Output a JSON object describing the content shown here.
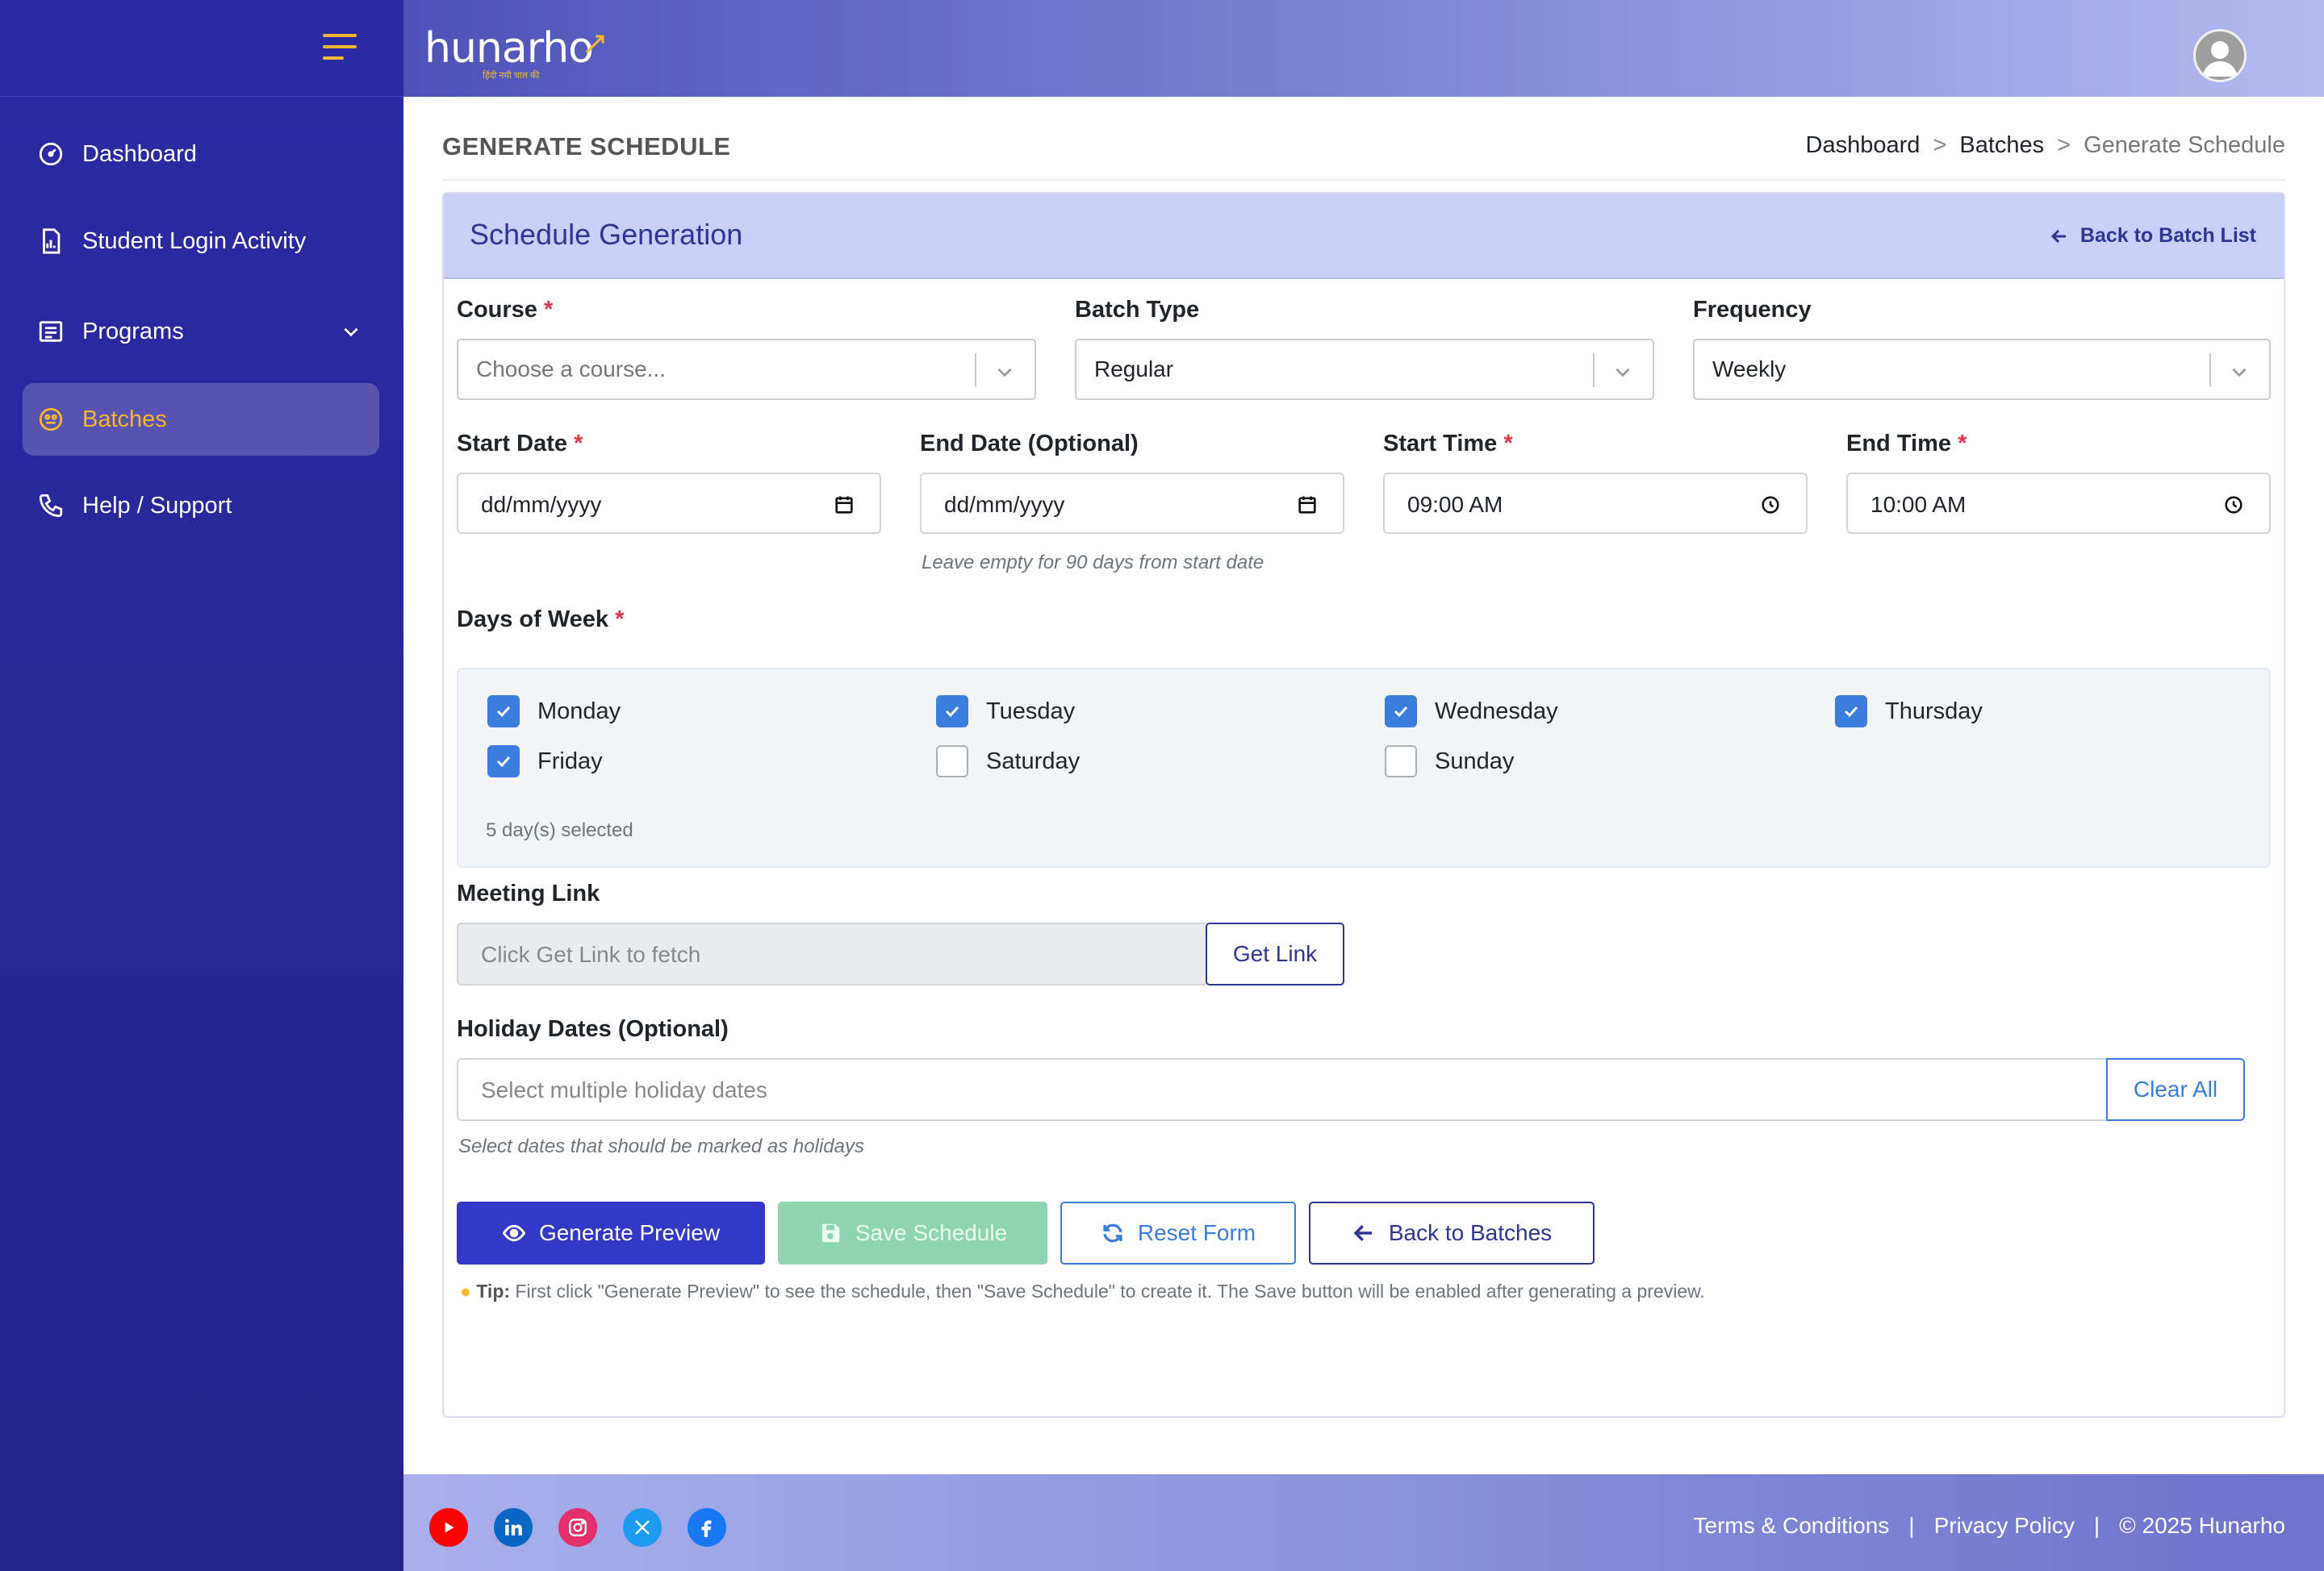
{
  "brand": {
    "logo_text": "hunarho",
    "logo_tagline": "हिंदी नयी चाल की"
  },
  "sidebar": {
    "items": [
      {
        "label": "Dashboard"
      },
      {
        "label": "Student Login Activity"
      },
      {
        "label": "Programs"
      },
      {
        "label": "Batches"
      },
      {
        "label": "Help / Support"
      }
    ],
    "active": "Batches"
  },
  "page": {
    "title": "GENERATE SCHEDULE",
    "breadcrumb": [
      "Dashboard",
      "Batches",
      "Generate Schedule"
    ],
    "breadcrumb_sep": ">"
  },
  "card": {
    "title": "Schedule Generation",
    "back_link": "Back to Batch List"
  },
  "form": {
    "course": {
      "label": "Course",
      "placeholder": "Choose a course..."
    },
    "batch_type": {
      "label": "Batch Type",
      "value": "Regular"
    },
    "frequency": {
      "label": "Frequency",
      "value": "Weekly"
    },
    "start_date": {
      "label": "Start Date",
      "value": "dd/mm/yyyy"
    },
    "end_date": {
      "label": "End Date (Optional)",
      "value": "dd/mm/yyyy",
      "hint": "Leave empty for 90 days from start date"
    },
    "start_time": {
      "label": "Start Time",
      "value": "09:00  AM"
    },
    "end_time": {
      "label": "End Time",
      "value": "10:00  AM"
    },
    "required_mark": "*",
    "days_of_week": {
      "label": "Days of Week",
      "days": [
        {
          "name": "Monday",
          "checked": true
        },
        {
          "name": "Tuesday",
          "checked": true
        },
        {
          "name": "Wednesday",
          "checked": true
        },
        {
          "name": "Thursday",
          "checked": true
        },
        {
          "name": "Friday",
          "checked": true
        },
        {
          "name": "Saturday",
          "checked": false
        },
        {
          "name": "Sunday",
          "checked": false
        }
      ],
      "selected_text": "5 day(s) selected"
    },
    "meeting_link": {
      "label": "Meeting Link",
      "placeholder": "Click Get Link to fetch",
      "button": "Get Link"
    },
    "holiday_dates": {
      "label": "Holiday Dates (Optional)",
      "placeholder": "Select multiple holiday dates",
      "button": "Clear All",
      "hint": "Select dates that should be marked as holidays"
    }
  },
  "actions": {
    "generate_preview": "Generate Preview",
    "save_schedule": "Save Schedule",
    "reset_form": "Reset Form",
    "back_to_batches": "Back to Batches"
  },
  "tip": {
    "label": "Tip:",
    "text": " First click \"Generate Preview\" to see the schedule, then \"Save Schedule\" to create it. The Save button will be enabled after generating a preview."
  },
  "footer": {
    "social": [
      "youtube-icon",
      "linkedin-icon",
      "instagram-icon",
      "x-twitter-icon",
      "facebook-icon"
    ],
    "links": [
      "Terms & Conditions",
      "Privacy Policy",
      "© 2025 Hunarho"
    ],
    "link_sep": "|"
  },
  "colors": {
    "sidebar_bg": "#2b2aa3",
    "accent": "#f5b731",
    "primary": "#3339c4",
    "success": "#8fd4b0",
    "info": "#3b7ddd",
    "card_header": "#c9d0f7"
  }
}
